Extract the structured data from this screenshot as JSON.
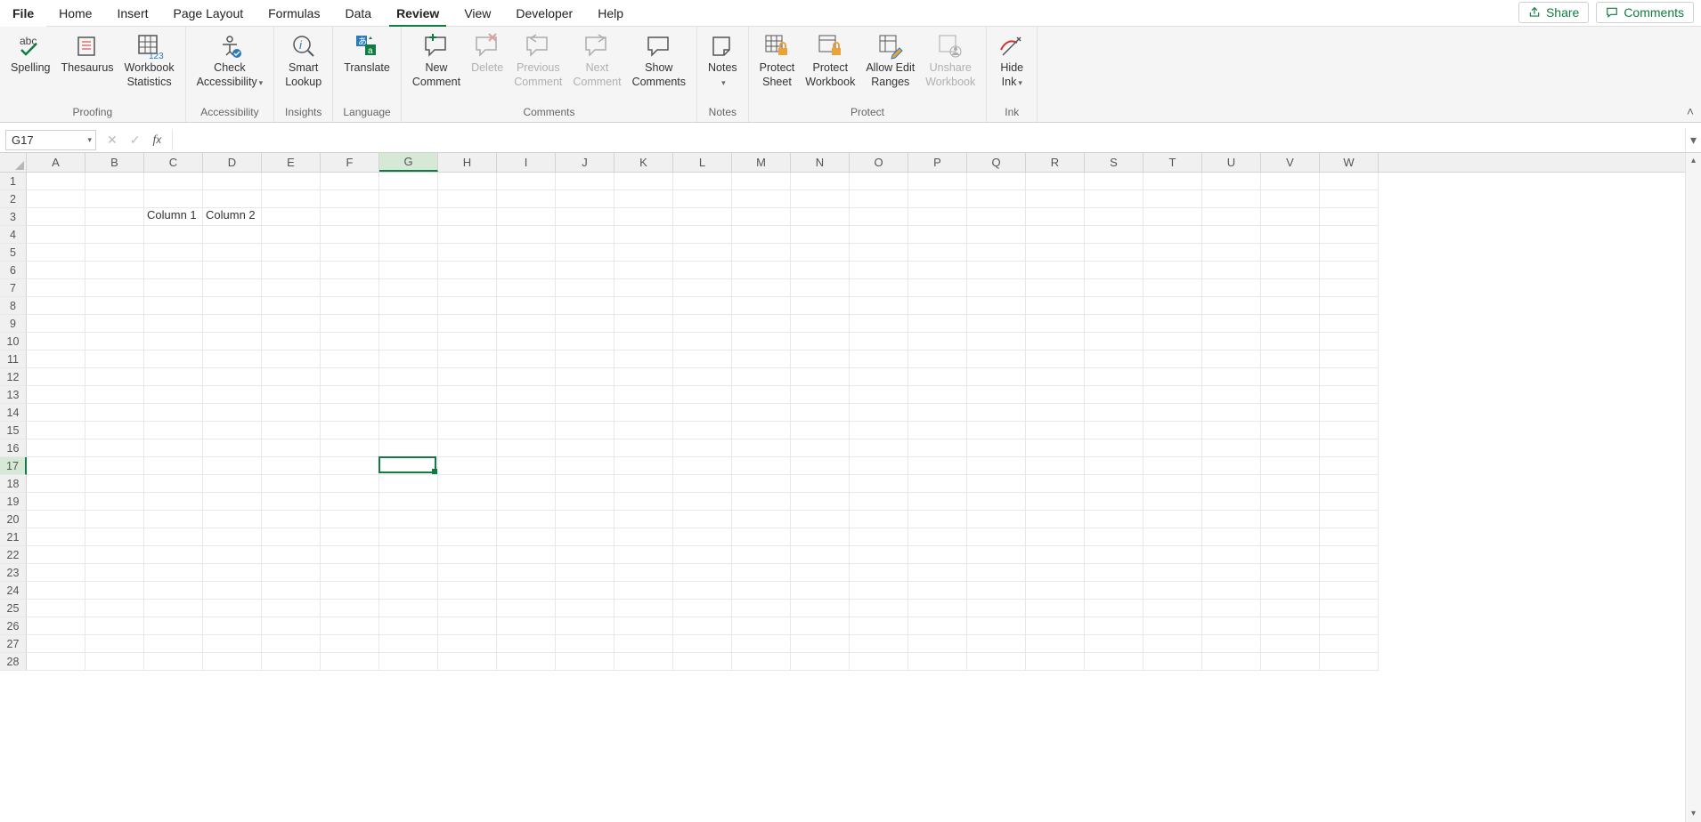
{
  "tabs": {
    "file": "File",
    "items": [
      "Home",
      "Insert",
      "Page Layout",
      "Formulas",
      "Data",
      "Review",
      "View",
      "Developer",
      "Help"
    ],
    "active": "Review",
    "share": "Share",
    "comments": "Comments"
  },
  "ribbon": {
    "groups": {
      "proofing": {
        "label": "Proofing",
        "spelling": "Spelling",
        "thesaurus": "Thesaurus",
        "workbook_stats": "Workbook\nStatistics"
      },
      "accessibility": {
        "label": "Accessibility",
        "check": "Check\nAccessibility"
      },
      "insights": {
        "label": "Insights",
        "smart_lookup": "Smart\nLookup"
      },
      "language": {
        "label": "Language",
        "translate": "Translate"
      },
      "comments": {
        "label": "Comments",
        "new": "New\nComment",
        "delete": "Delete",
        "previous": "Previous\nComment",
        "next": "Next\nComment",
        "show": "Show\nComments"
      },
      "notes": {
        "label": "Notes",
        "notes": "Notes"
      },
      "protect": {
        "label": "Protect",
        "sheet": "Protect\nSheet",
        "workbook": "Protect\nWorkbook",
        "ranges": "Allow Edit\nRanges",
        "unshare": "Unshare\nWorkbook"
      },
      "ink": {
        "label": "Ink",
        "hide": "Hide\nInk"
      }
    }
  },
  "formula_bar": {
    "name_box": "G17",
    "formula": ""
  },
  "grid": {
    "columns": [
      "A",
      "B",
      "C",
      "D",
      "E",
      "F",
      "G",
      "H",
      "I",
      "J",
      "K",
      "L",
      "M",
      "N",
      "O",
      "P",
      "Q",
      "R",
      "S",
      "T",
      "U",
      "V",
      "W"
    ],
    "rows": 28,
    "active_col": "G",
    "active_row": 17,
    "cells": {
      "C3": "Column 1",
      "D3": "Column 2"
    }
  }
}
